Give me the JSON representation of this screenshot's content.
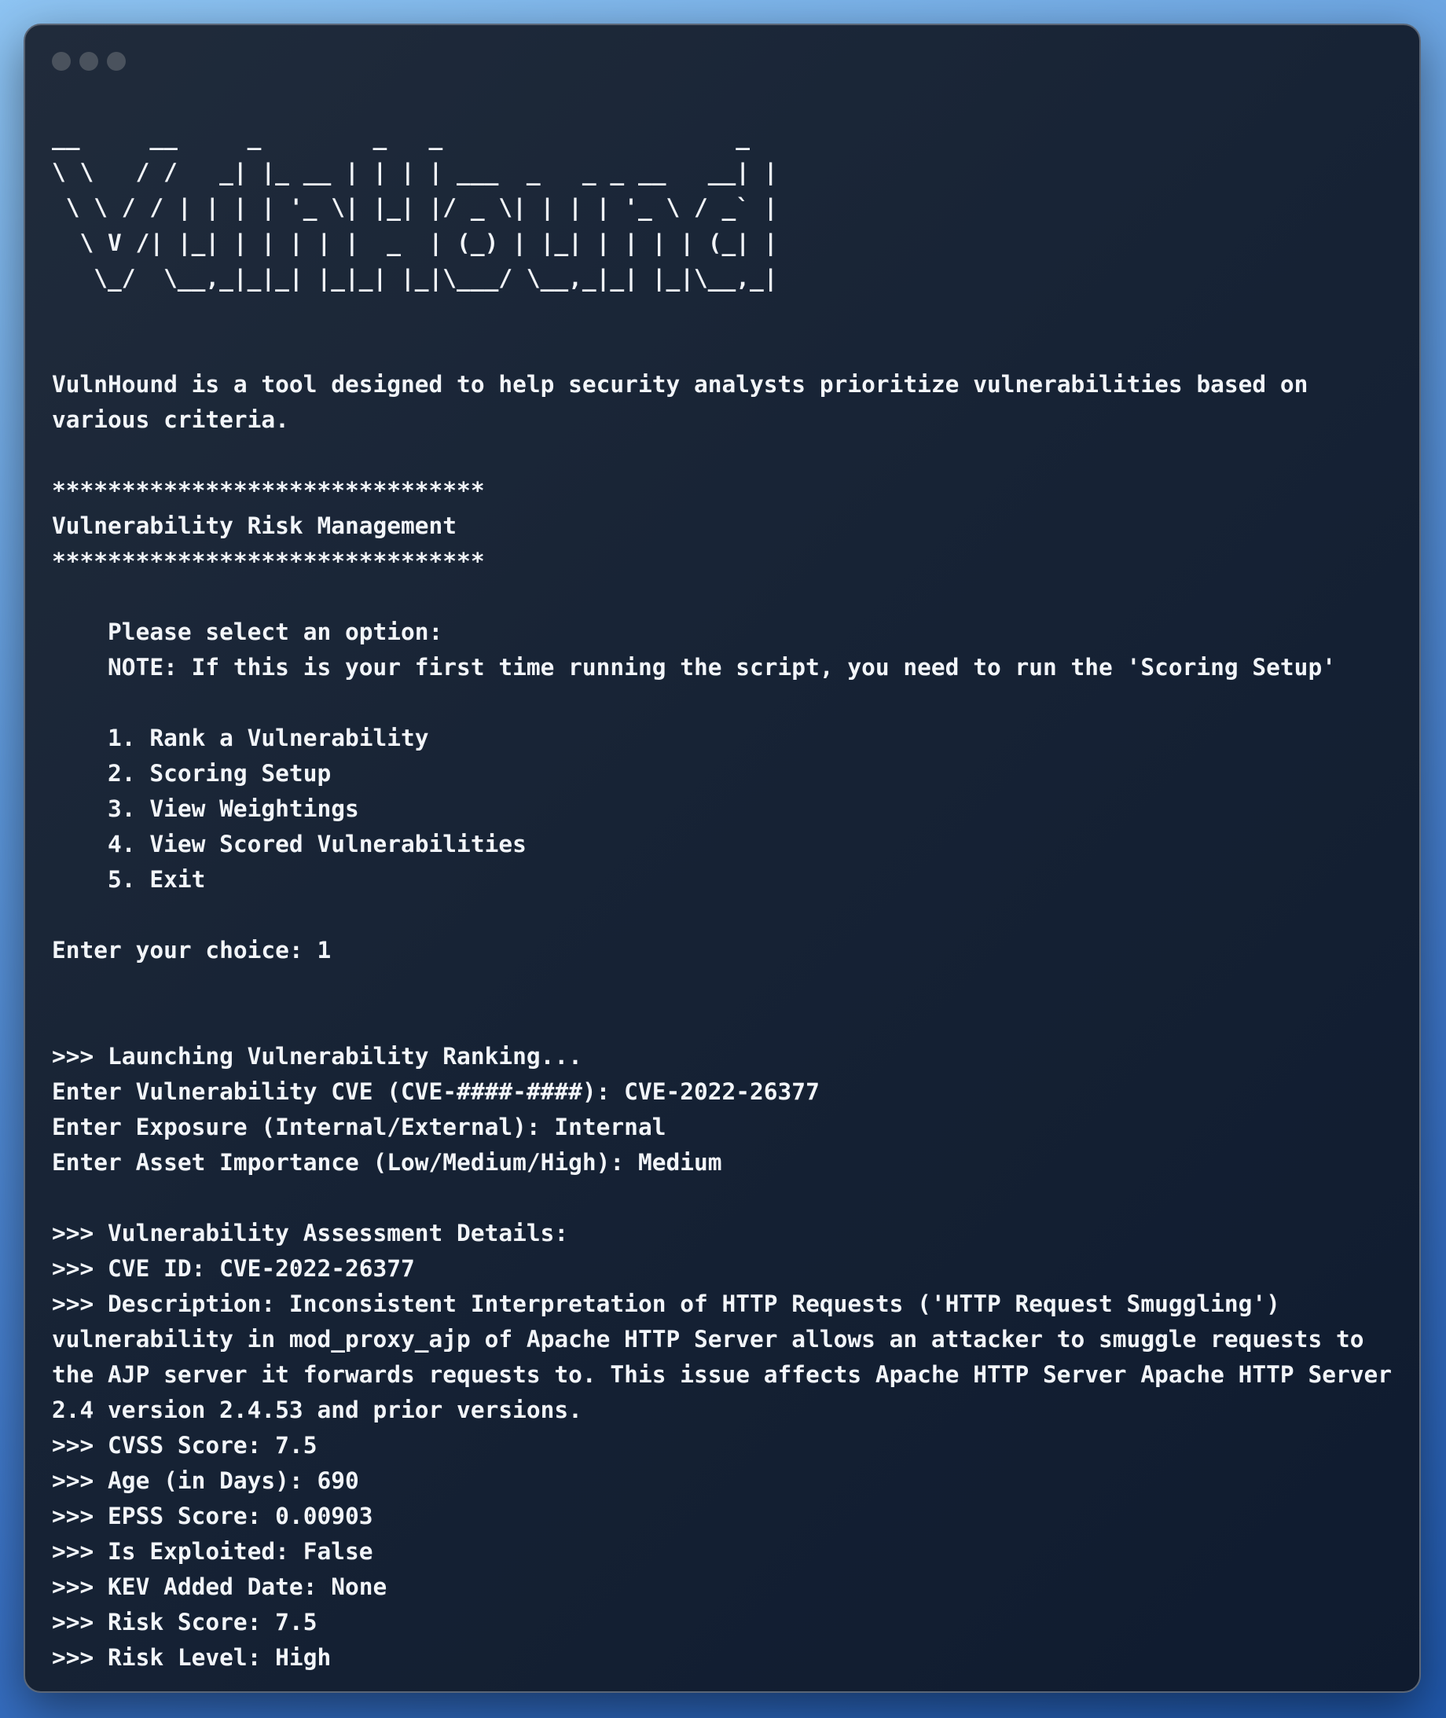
{
  "window": {
    "controls": [
      "window-dot",
      "window-dot",
      "window-dot"
    ]
  },
  "banner_lines": [
    "__     __     _        _   _                     _ ",
    "\\ \\   / /   _| |_ __ | | | | ___  _   _ _ __   __| |",
    " \\ \\ / / | | | | '_ \\| |_| |/ _ \\| | | | '_ \\ / _` |",
    "  \\ V /| |_| | | | | |  _  | (_) | |_| | | | | (_| |",
    "   \\_/  \\__,_|_|_| |_|_| |_|\\___/ \\__,_|_| |_|\\__,_|"
  ],
  "intro": "VulnHound is a tool designed to help security analysts prioritize vulnerabilities based on various criteria.",
  "header": {
    "stars": "*******************************",
    "title": "Vulnerability Risk Management"
  },
  "menu": {
    "prompt": "    Please select an option:",
    "note": "    NOTE: If this is your first time running the script, you need to run the 'Scoring Setup'",
    "options": [
      "    1. Rank a Vulnerability",
      "    2. Scoring Setup",
      "    3. View Weightings",
      "    4. View Scored Vulnerabilities",
      "    5. Exit"
    ],
    "choice": "Enter your choice: 1"
  },
  "ranking": {
    "launch": ">>> Launching Vulnerability Ranking...",
    "cve_input": "Enter Vulnerability CVE (CVE-####-####): CVE-2022-26377",
    "exposure_input": "Enter Exposure (Internal/External): Internal",
    "asset_input": "Enter Asset Importance (Low/Medium/High): Medium"
  },
  "details": {
    "heading": ">>> Vulnerability Assessment Details:",
    "cve_id": ">>> CVE ID: CVE-2022-26377",
    "description": ">>> Description: Inconsistent Interpretation of HTTP Requests ('HTTP Request Smuggling') vulnerability in mod_proxy_ajp of Apache HTTP Server allows an attacker to smuggle requests to the AJP server it forwards requests to. This issue affects Apache HTTP Server Apache HTTP Server 2.4 version 2.4.53 and prior versions.",
    "cvss": ">>> CVSS Score: 7.5",
    "age": ">>> Age (in Days): 690",
    "epss": ">>> EPSS Score: 0.00903",
    "exploited": ">>> Is Exploited: False",
    "kev": ">>> KEV Added Date: None",
    "risk_score": ">>> Risk Score: 7.5",
    "risk_level": ">>> Risk Level: High"
  }
}
